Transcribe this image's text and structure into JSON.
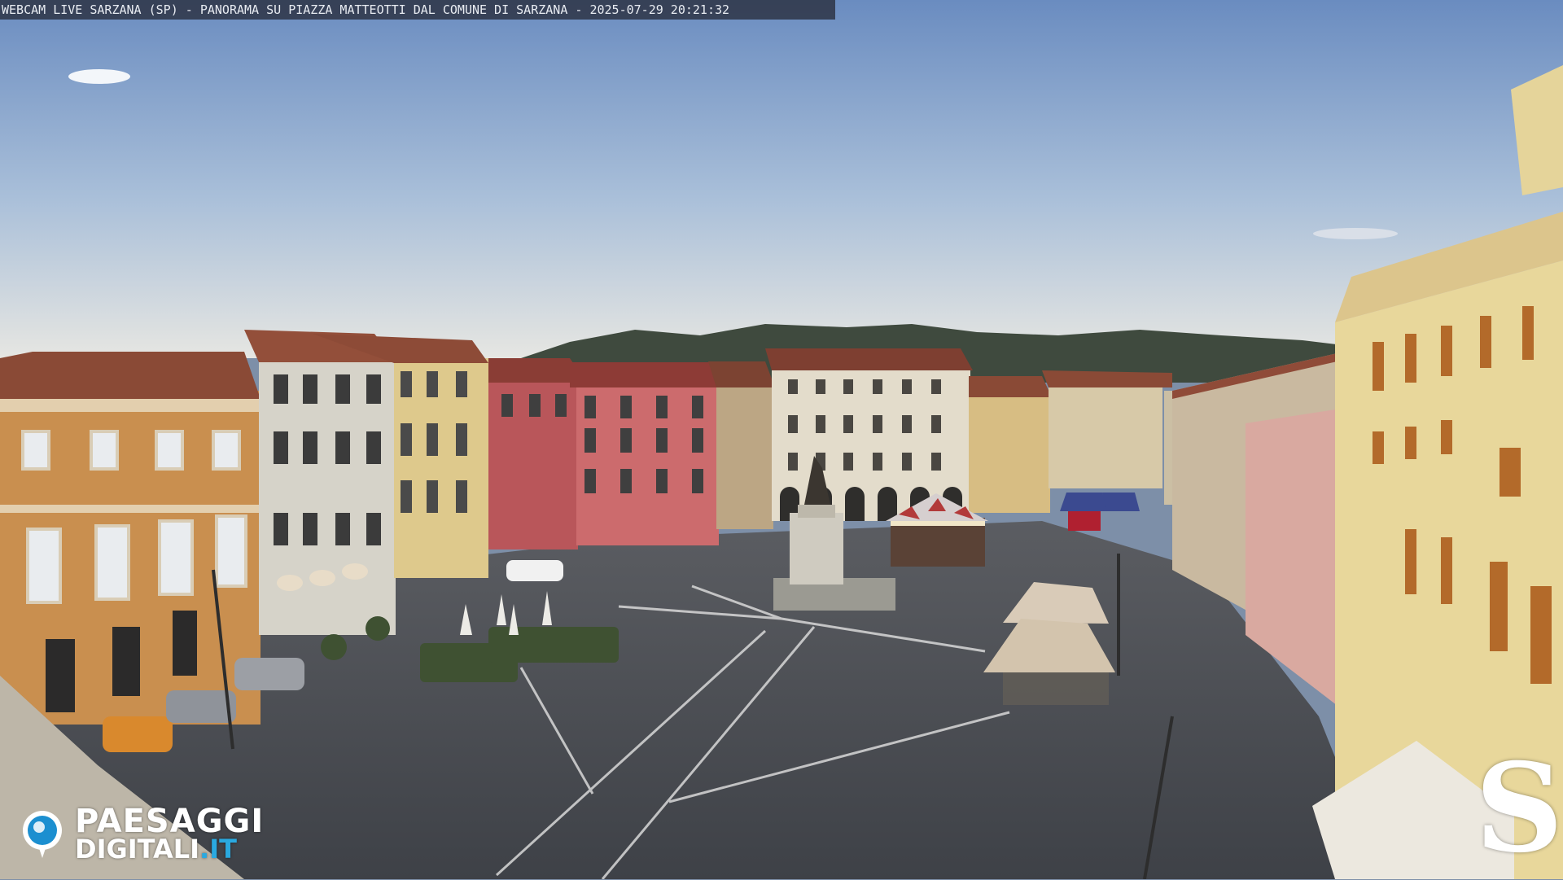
{
  "overlay": {
    "caption": "WEBCAM LIVE SARZANA (SP) - PANORAMA SU PIAZZA MATTEOTTI DAL COMUNE DI SARZANA - 2025-07-29  20:21:32"
  },
  "branding": {
    "logo_line1": "PAESAGGI",
    "logo_line2_main": "DIGITALI",
    "logo_line2_tld": ".IT",
    "corner_mark": "S"
  },
  "colors": {
    "sky_top": "#6f8fc0",
    "sky_bottom": "#dfe5ea",
    "pavement": "#4a4d54",
    "accent_logo": "#2aa9e0"
  }
}
